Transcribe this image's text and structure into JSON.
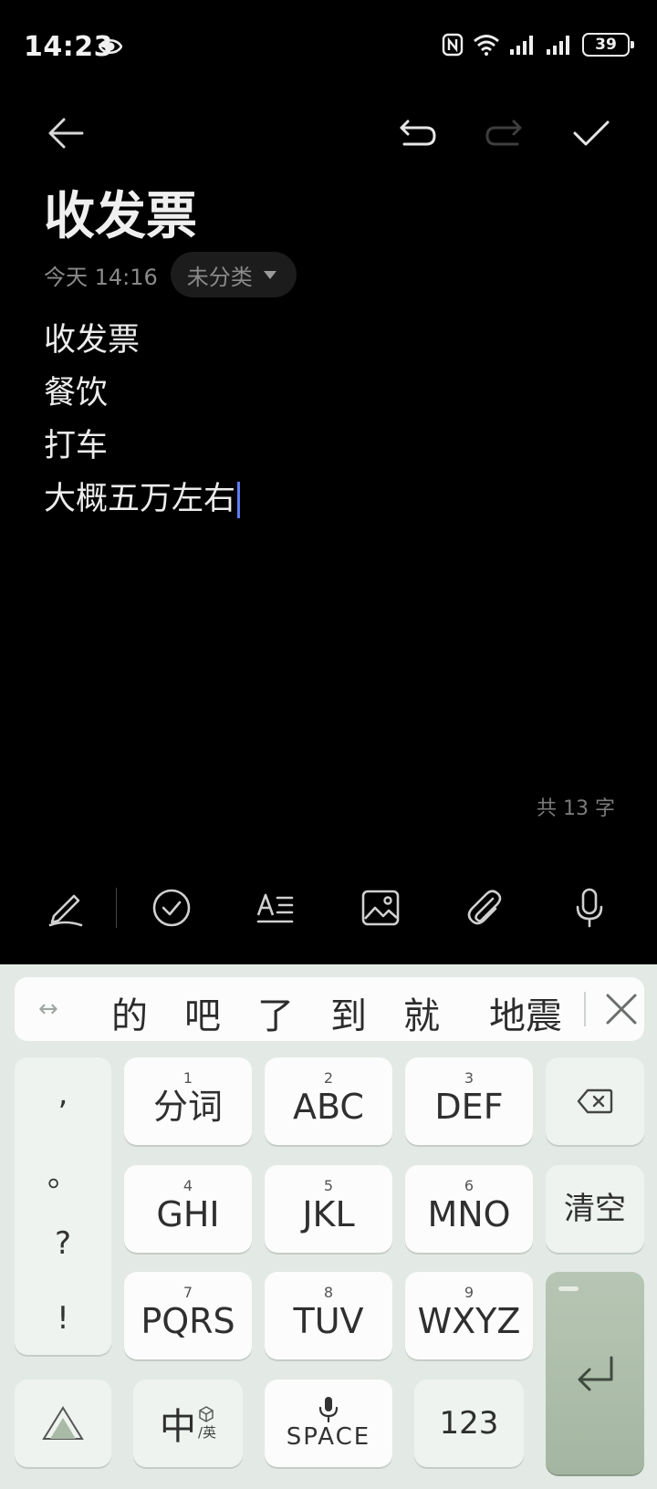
{
  "status_bar": {
    "time": "14:23",
    "battery": "39"
  },
  "note": {
    "title": "收发票",
    "date": "今天 14:16",
    "category": "未分类",
    "lines": [
      "收发票",
      "餐饮",
      "打车",
      "大概五万左右"
    ],
    "word_count": "共 13 字"
  },
  "keyboard": {
    "candidates": [
      "的",
      "吧",
      "了",
      "到",
      "就",
      "地震"
    ],
    "swap_icon": "↔",
    "punctuation": [
      ",",
      "。",
      "?",
      "!"
    ],
    "keys": [
      {
        "num": "1",
        "label": "分词"
      },
      {
        "num": "2",
        "label": "ABC"
      },
      {
        "num": "3",
        "label": "DEF"
      },
      {
        "num": "4",
        "label": "GHI"
      },
      {
        "num": "5",
        "label": "JKL"
      },
      {
        "num": "6",
        "label": "MNO"
      },
      {
        "num": "7",
        "label": "PQRS"
      },
      {
        "num": "8",
        "label": "TUV"
      },
      {
        "num": "9",
        "label": "WXYZ"
      }
    ],
    "clear_label": "清空",
    "lang_main": "中",
    "lang_sub": "/英",
    "space_label": "SPACE",
    "num_label": "123"
  },
  "colors": {
    "cursor": "#5c7cf2",
    "enter_key": "#a9bba6",
    "keyboard_bg": "#e3e9e4"
  }
}
